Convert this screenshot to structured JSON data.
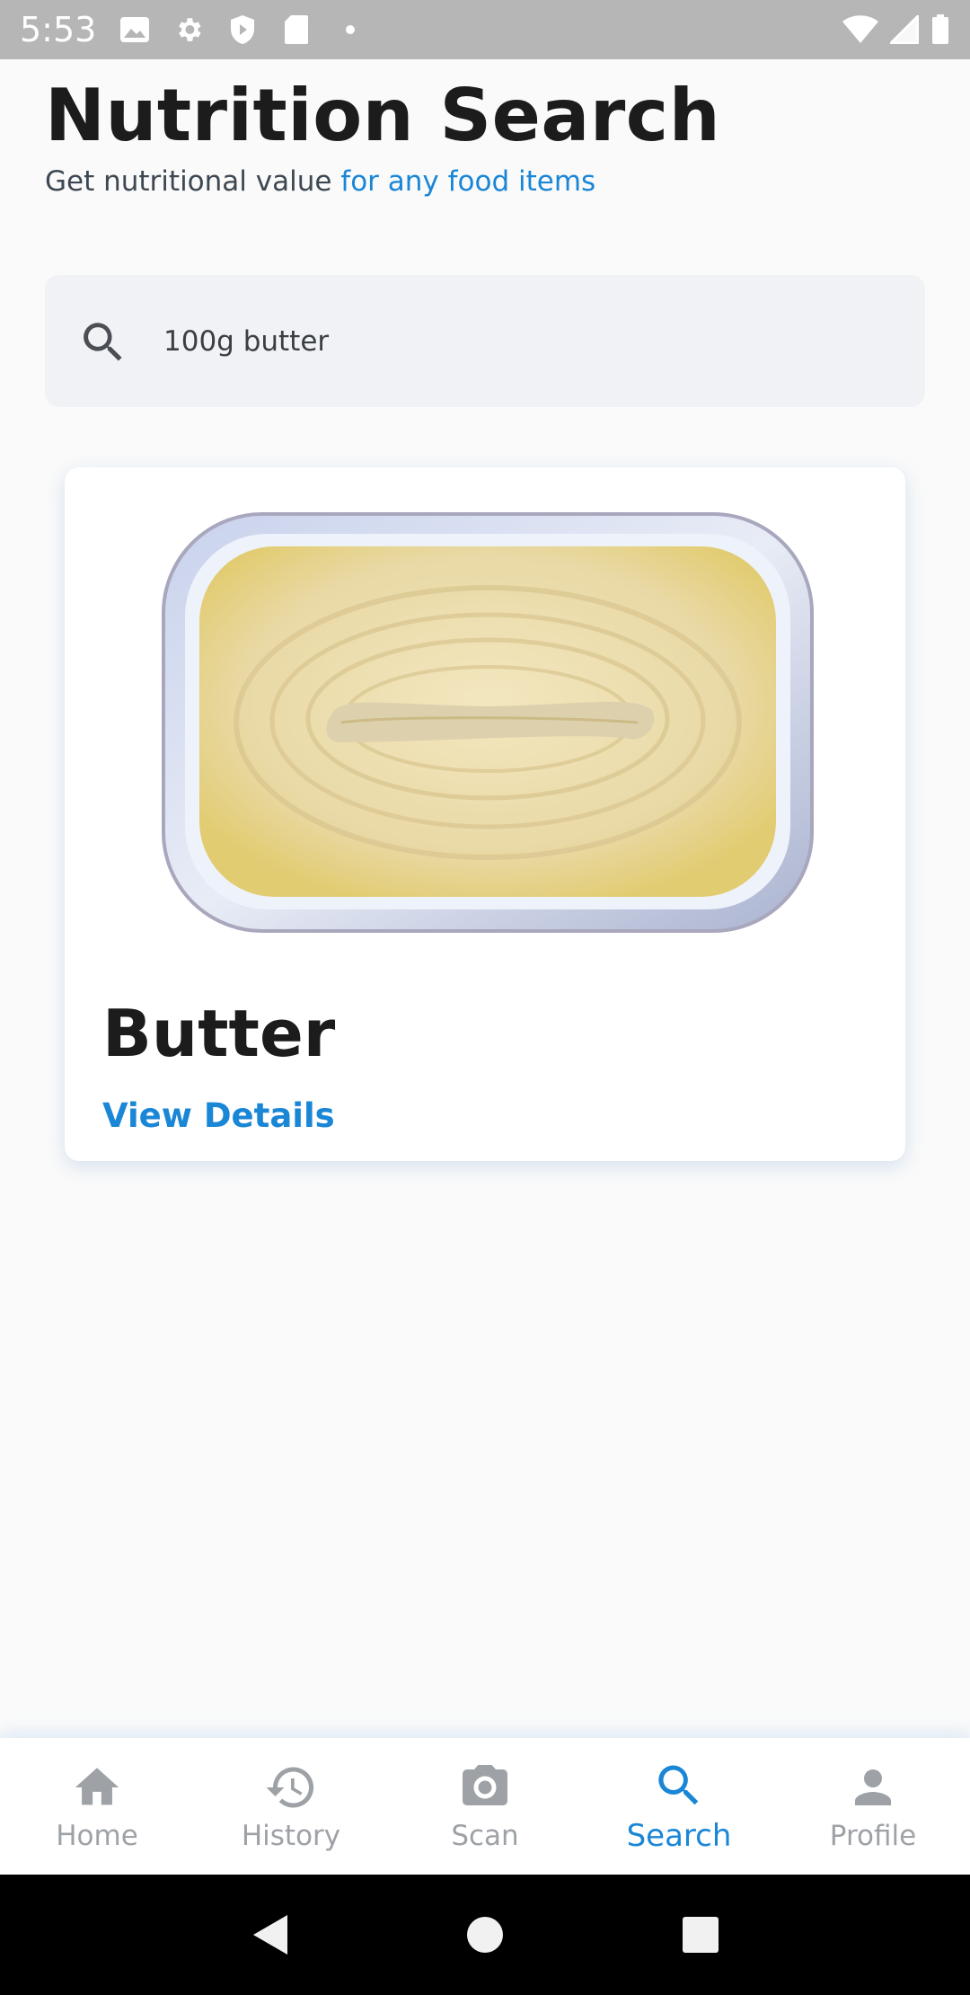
{
  "status_bar": {
    "time": "5:53",
    "icons_left": [
      "image-icon",
      "gear-icon",
      "shield-icon",
      "sd-card-icon",
      "dot-icon"
    ],
    "icons_right": [
      "wifi-icon",
      "signal-icon",
      "battery-icon"
    ]
  },
  "header": {
    "title": "Nutrition Search",
    "subtitle_plain": "Get nutritional value ",
    "subtitle_accent": "for any food items"
  },
  "search": {
    "value": "100g butter",
    "icon": "search-icon"
  },
  "result": {
    "name": "Butter",
    "action_label": "View Details",
    "image": "butter-tub-image"
  },
  "bottom_nav": {
    "active": "Search",
    "items": [
      {
        "label": "Home",
        "icon": "home-icon"
      },
      {
        "label": "History",
        "icon": "history-icon"
      },
      {
        "label": "Scan",
        "icon": "camera-icon"
      },
      {
        "label": "Search",
        "icon": "search-icon"
      },
      {
        "label": "Profile",
        "icon": "person-icon"
      }
    ]
  },
  "colors": {
    "accent": "#1a86d6",
    "inactive": "#9ea2a7",
    "title": "#1c1c1c",
    "status_bar": "#b6b6b6"
  }
}
